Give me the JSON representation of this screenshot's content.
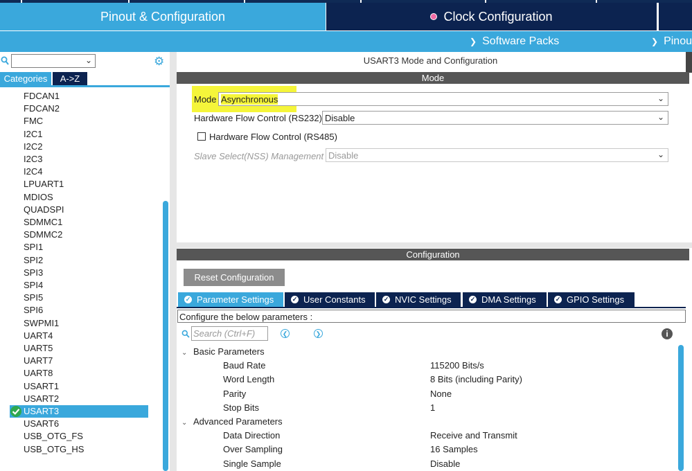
{
  "top_tabs": {
    "pinout": "Pinout & Configuration",
    "clock": "Clock Configuration"
  },
  "sub_menu": {
    "software_packs": "Software Packs",
    "pinout": "Pinout"
  },
  "left": {
    "categories_tab": "Categories",
    "az_tab": "A->Z",
    "peripherals": [
      "FDCAN1",
      "FDCAN2",
      "FMC",
      "I2C1",
      "I2C2",
      "I2C3",
      "I2C4",
      "LPUART1",
      "MDIOS",
      "QUADSPI",
      "SDMMC1",
      "SDMMC2",
      "SPI1",
      "SPI2",
      "SPI3",
      "SPI4",
      "SPI5",
      "SPI6",
      "SWPMI1",
      "UART4",
      "UART5",
      "UART7",
      "UART8",
      "USART1",
      "USART2",
      "USART3",
      "USART6",
      "USB_OTG_FS",
      "USB_OTG_HS"
    ],
    "selected": "USART3"
  },
  "mode": {
    "title": "USART3 Mode and Configuration",
    "header": "Mode",
    "mode_label": "Mode",
    "mode_value": "Asynchronous",
    "hfc232_label": "Hardware Flow Control (RS232)",
    "hfc232_value": "Disable",
    "hfc485_label": "Hardware Flow Control (RS485)",
    "nss_label": "Slave Select(NSS) Management",
    "nss_value": "Disable"
  },
  "config": {
    "header": "Configuration",
    "reset_button": "Reset Configuration",
    "tabs": [
      "Parameter Settings",
      "User Constants",
      "NVIC Settings",
      "DMA Settings",
      "GPIO Settings"
    ],
    "instructions": "Configure the below parameters :",
    "search_placeholder": "Search (Ctrl+F)",
    "groups": [
      {
        "name": "Basic Parameters",
        "params": [
          {
            "name": "Baud Rate",
            "value": "115200 Bits/s"
          },
          {
            "name": "Word Length",
            "value": "8 Bits (including Parity)"
          },
          {
            "name": "Parity",
            "value": "None"
          },
          {
            "name": "Stop Bits",
            "value": "1"
          }
        ]
      },
      {
        "name": "Advanced Parameters",
        "params": [
          {
            "name": "Data Direction",
            "value": "Receive and Transmit"
          },
          {
            "name": "Over Sampling",
            "value": "16 Samples"
          },
          {
            "name": "Single Sample",
            "value": "Disable"
          }
        ]
      }
    ]
  },
  "colors": {
    "accent": "#3aa8dc",
    "navy": "#0c2350",
    "highlight": "#f5f53a",
    "header_gray": "#565656"
  }
}
